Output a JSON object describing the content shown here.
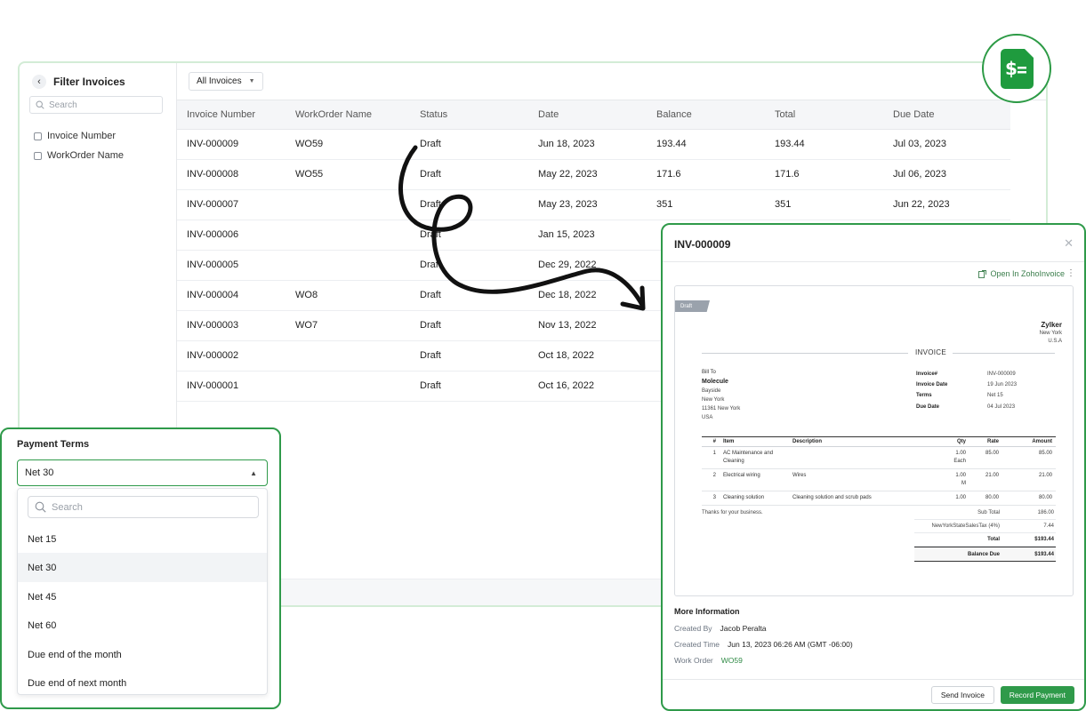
{
  "sidebar": {
    "title": "Filter Invoices",
    "search_placeholder": "Search",
    "filters": [
      "Invoice Number",
      "WorkOrder Name"
    ]
  },
  "toolbar": {
    "view_label": "All Invoices"
  },
  "table": {
    "columns": [
      "Invoice Number",
      "WorkOrder Name",
      "Status",
      "Date",
      "Balance",
      "Total",
      "Due Date"
    ],
    "rows": [
      [
        "INV-000009",
        "WO59",
        "Draft",
        "Jun 18, 2023",
        "193.44",
        "193.44",
        "Jul 03, 2023"
      ],
      [
        "INV-000008",
        "WO55",
        "Draft",
        "May 22, 2023",
        "171.6",
        "171.6",
        "Jul 06, 2023"
      ],
      [
        "INV-000007",
        "",
        "Draft",
        "May 23, 2023",
        "351",
        "351",
        "Jun 22, 2023"
      ],
      [
        "INV-000006",
        "",
        "Draft",
        "Jan 15, 2023",
        "",
        "",
        ""
      ],
      [
        "INV-000005",
        "",
        "Draft",
        "Dec 29, 2022",
        "",
        "",
        ""
      ],
      [
        "INV-000004",
        "WO8",
        "Draft",
        "Dec 18, 2022",
        "",
        "",
        ""
      ],
      [
        "INV-000003",
        "WO7",
        "Draft",
        "Nov 13, 2022",
        "",
        "",
        ""
      ],
      [
        "INV-000002",
        "",
        "Draft",
        "Oct 18, 2022",
        "",
        "",
        ""
      ],
      [
        "INV-000001",
        "",
        "Draft",
        "Oct 16, 2022",
        "",
        "",
        ""
      ]
    ]
  },
  "payment_terms": {
    "label": "Payment Terms",
    "selected": "Net 30",
    "search_placeholder": "Search",
    "options": [
      "Net 15",
      "Net 30",
      "Net 45",
      "Net 60",
      "Due end of the month",
      "Due end of next month"
    ],
    "selected_index": 1
  },
  "detail": {
    "title": "INV-000009",
    "open_link": "Open In ZohoInvoice",
    "draft_badge": "Draft",
    "org": {
      "name": "Zylker",
      "lines": [
        "New York",
        "U.S.A"
      ]
    },
    "heading": "INVOICE",
    "bill_to": {
      "label": "Bill To",
      "name": "Molecule",
      "lines": [
        "Bayside",
        "New York",
        "11361 New York",
        "USA"
      ]
    },
    "meta": [
      {
        "k": "Invoice#",
        "v": "INV-000009"
      },
      {
        "k": "Invoice Date",
        "v": "19 Jun 2023"
      },
      {
        "k": "Terms",
        "v": "Net 15"
      },
      {
        "k": "Due Date",
        "v": "04 Jul 2023"
      }
    ],
    "item_columns": [
      "#",
      "Item",
      "Description",
      "Qty",
      "Rate",
      "Amount"
    ],
    "items": [
      {
        "n": "1",
        "item": "AC Maintenance and Cleaning",
        "desc": "",
        "qty": "1.00",
        "unit": "Each",
        "rate": "85.00",
        "amount": "85.00"
      },
      {
        "n": "2",
        "item": "Electrical wiring",
        "desc": "Wires",
        "qty": "1.00",
        "unit": "M",
        "rate": "21.00",
        "amount": "21.00"
      },
      {
        "n": "3",
        "item": "Cleaning solution",
        "desc": "Cleaning solution and scrub pads",
        "qty": "1.00",
        "unit": "",
        "rate": "80.00",
        "amount": "80.00"
      }
    ],
    "thanks": "Thanks for your business.",
    "totals": [
      {
        "k": "Sub Total",
        "v": "186.00"
      },
      {
        "k": "NewYorkStateSalesTax (4%)",
        "v": "7.44"
      },
      {
        "k": "Total",
        "v": "$193.44"
      },
      {
        "k": "Balance Due",
        "v": "$193.44"
      }
    ],
    "more_info": {
      "title": "More Information",
      "rows": [
        {
          "k": "Created By",
          "v": "Jacob Peralta"
        },
        {
          "k": "Created Time",
          "v": "Jun 13, 2023 06:26 AM (GMT -06:00)"
        },
        {
          "k": "Work Order",
          "v": "WO59"
        }
      ]
    },
    "buttons": {
      "send": "Send Invoice",
      "record": "Record Payment"
    }
  },
  "colors": {
    "brand_green": "#2f9a4a",
    "logo_green": "#1f9b3e",
    "link_green": "#2f8a45"
  },
  "icons": [
    "back-chevron-icon",
    "search-icon",
    "logo-dollar-doc-icon",
    "caret-down-icon",
    "caret-up-icon",
    "close-icon",
    "open-external-icon",
    "more-vertical-icon"
  ]
}
